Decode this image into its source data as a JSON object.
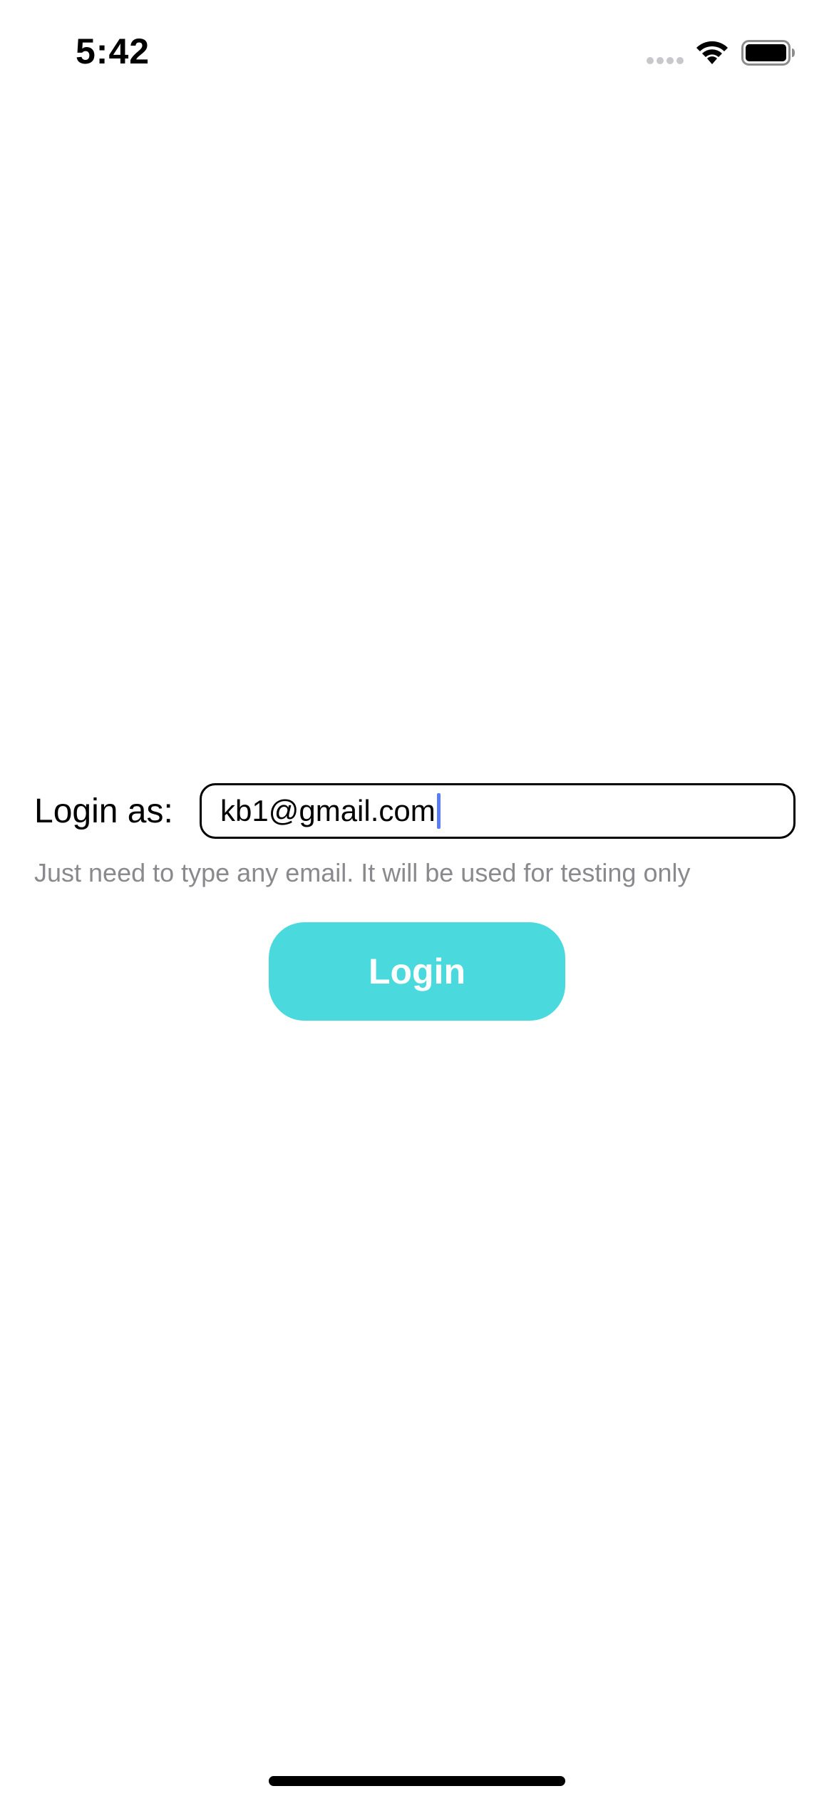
{
  "status_bar": {
    "time": "5:42",
    "signal_icon": "cellular-signal-icon",
    "wifi_icon": "wifi-icon",
    "battery_icon": "battery-icon"
  },
  "login": {
    "label": "Login as:",
    "email_value": "kb1@gmail.com",
    "helper_text": "Just need to type any email. It will be used for testing only",
    "button_label": "Login"
  },
  "colors": {
    "button_background": "#4ad9dc",
    "button_text": "#ffffff",
    "helper_text": "#8a8a8e",
    "caret": "#5b7cf7"
  }
}
